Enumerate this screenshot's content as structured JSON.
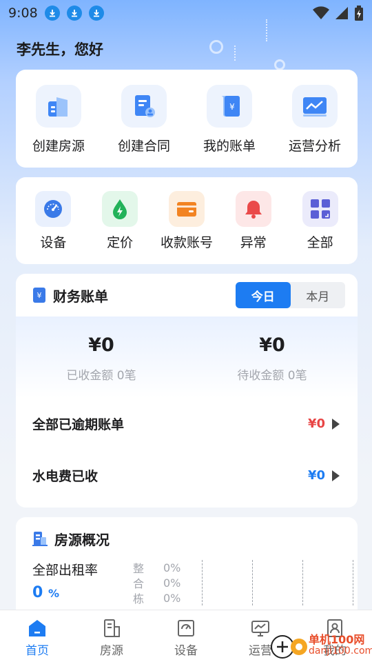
{
  "status": {
    "time": "9:08"
  },
  "greeting": "李先生，您好",
  "quick_actions": [
    {
      "label": "创建房源",
      "icon": "building-icon"
    },
    {
      "label": "创建合同",
      "icon": "contract-icon"
    },
    {
      "label": "我的账单",
      "icon": "bill-icon"
    },
    {
      "label": "运营分析",
      "icon": "analytics-icon"
    }
  ],
  "tools": [
    {
      "label": "设备",
      "icon": "gauge-icon",
      "bg": "#e9f0fd",
      "color": "#3a7ae8"
    },
    {
      "label": "定价",
      "icon": "drop-icon",
      "bg": "#e3f7ea",
      "color": "#23b25a"
    },
    {
      "label": "收款账号",
      "icon": "wallet-icon",
      "bg": "#fdeede",
      "color": "#f28322"
    },
    {
      "label": "异常",
      "icon": "bell-icon",
      "bg": "#fde7e7",
      "color": "#ea4a4a"
    },
    {
      "label": "全部",
      "icon": "grid-icon",
      "bg": "#ebebfb",
      "color": "#5b5fd6"
    }
  ],
  "finance": {
    "title": "财务账单",
    "tabs": [
      "今日",
      "本月"
    ],
    "received_amount": "¥0",
    "received_desc": "已收金额 0笔",
    "pending_amount": "¥0",
    "pending_desc": "待收金额 0笔",
    "overdue_label": "全部已逾期账单",
    "overdue_value": "¥0",
    "utility_label": "水电费已收",
    "utility_value": "¥0",
    "colors": {
      "overdue": "#e84545",
      "utility": "#1d7cf2"
    }
  },
  "house": {
    "title": "房源概况",
    "occupancy_label": "全部出租率",
    "occupancy_value": "0",
    "occupancy_unit": "%",
    "stats": [
      {
        "name": "整",
        "value": "0%"
      },
      {
        "name": "合",
        "value": "0%"
      },
      {
        "name": "栋",
        "value": "0%"
      }
    ]
  },
  "tabbar": [
    {
      "label": "首页",
      "icon": "home-icon",
      "active": true
    },
    {
      "label": "房源",
      "icon": "house-list-icon",
      "active": false
    },
    {
      "label": "设备",
      "icon": "device-icon",
      "active": false
    },
    {
      "label": "运营",
      "icon": "monitor-icon",
      "active": false
    },
    {
      "label": "我的",
      "icon": "profile-icon",
      "active": false
    }
  ],
  "watermark": {
    "text": "单机100网",
    "url": "danji100.com"
  }
}
